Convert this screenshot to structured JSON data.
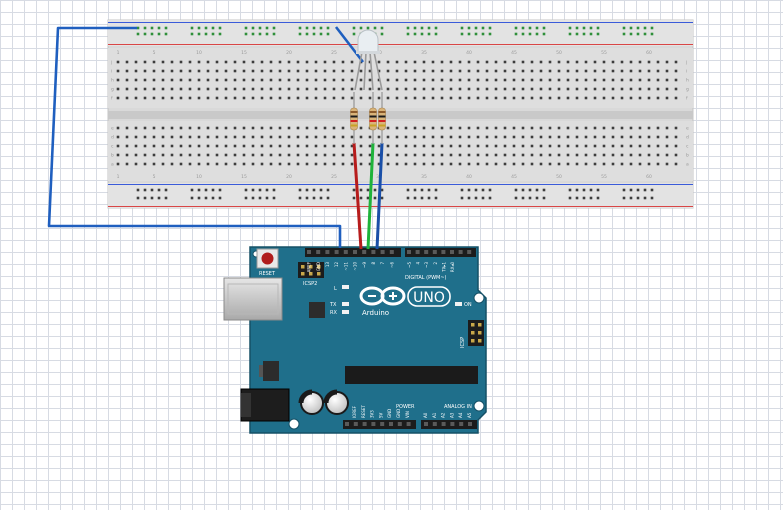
{
  "breadboard": {
    "row_letters": [
      "j",
      "i",
      "h",
      "g",
      "f",
      "e",
      "d",
      "c",
      "b",
      "a"
    ],
    "column_numbers": [
      "1",
      "5",
      "10",
      "15",
      "20",
      "25",
      "30",
      "35",
      "40",
      "45",
      "50",
      "55",
      "60"
    ]
  },
  "led": {
    "color": "#e9eef2"
  },
  "resistors": {
    "count": 3,
    "band_colors": [
      "#8b5a2b",
      "#1a1a1a",
      "#d21f1f",
      "#c9a227"
    ]
  },
  "wires": {
    "blue": "#1f5fbf",
    "red": "#cc1f1f",
    "green": "#1fb33a",
    "blue_dark": "#1a4fa8"
  },
  "arduino": {
    "board_color": "#1f6f8b",
    "logo_text": "Arduino",
    "model_label": "UNO",
    "reset_label": "RESET",
    "icsp_label": "ICSP",
    "icsp2_label": "ICSP2",
    "digital_label": "DIGITAL (PWM~)",
    "analog_label": "ANALOG IN",
    "power_label": "POWER",
    "on_label": "ON",
    "l_label": "L",
    "tx_label": "TX",
    "rx_label": "RX",
    "digital_pins": [
      "AREF",
      "GND",
      "13",
      "12",
      "~11",
      "~10",
      "~9",
      "8",
      "7",
      "~6",
      "~5",
      "4",
      "~3",
      "2",
      "TX▸1",
      "RX◂0"
    ],
    "power_pins": [
      "IOREF",
      "RESET",
      "3V3",
      "5V",
      "GND",
      "GND",
      "VIN"
    ],
    "analog_pins": [
      "A0",
      "A1",
      "A2",
      "A3",
      "A4",
      "A5"
    ]
  }
}
